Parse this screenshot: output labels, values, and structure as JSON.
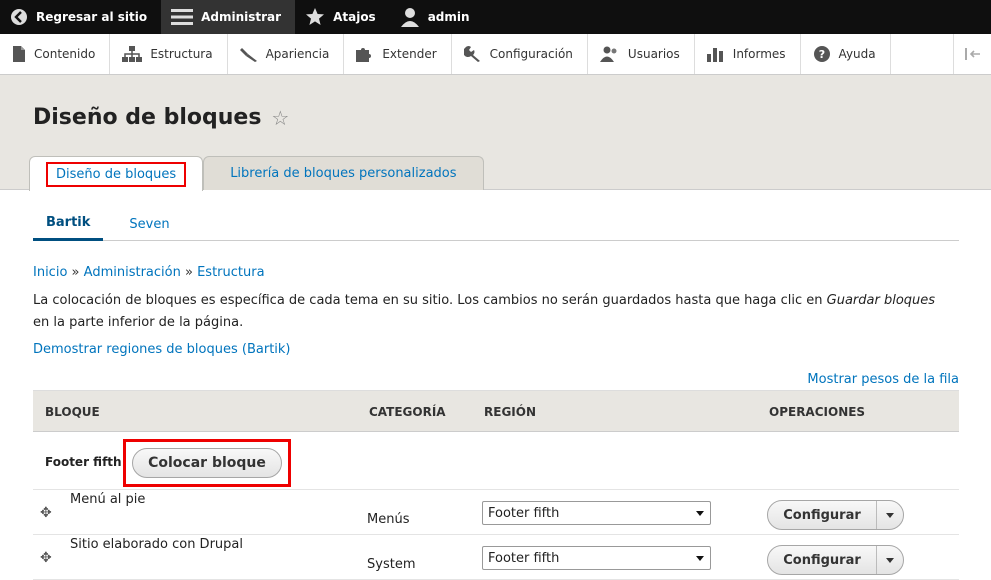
{
  "toolbar": {
    "back_label": "Regresar al sitio",
    "admin_label": "Administrar",
    "shortcuts_label": "Atajos",
    "user_label": "admin"
  },
  "tray": {
    "items": [
      {
        "label": "Contenido",
        "icon": "file-icon"
      },
      {
        "label": "Estructura",
        "icon": "sitemap-icon"
      },
      {
        "label": "Apariencia",
        "icon": "brush-icon"
      },
      {
        "label": "Extender",
        "icon": "puzzle-icon"
      },
      {
        "label": "Configuración",
        "icon": "wrench-icon"
      },
      {
        "label": "Usuarios",
        "icon": "people-icon"
      },
      {
        "label": "Informes",
        "icon": "bar-chart-icon"
      },
      {
        "label": "Ayuda",
        "icon": "help-icon"
      }
    ]
  },
  "page": {
    "title": "Diseño de bloques",
    "tabs": [
      {
        "label": "Diseño de bloques"
      },
      {
        "label": "Librería de bloques personalizados"
      }
    ],
    "subtabs": [
      {
        "label": "Bartik"
      },
      {
        "label": "Seven"
      }
    ],
    "breadcrumb": {
      "home": "Inicio",
      "admin": "Administración",
      "structure": "Estructura",
      "sep": "»"
    },
    "description_pre": "La colocación de bloques es específica de cada tema en su sitio. Los cambios no serán guardados hasta que haga clic en ",
    "description_em": "Guardar bloques",
    "description_post": " en la parte inferior de la página.",
    "demo_link": "Demostrar regiones de bloques (Bartik)",
    "weights_link": "Mostrar pesos de la fila"
  },
  "table": {
    "headers": {
      "block": "BLOQUE",
      "category": "CATEGORÍA",
      "region": "REGIÓN",
      "operations": "OPERACIONES"
    },
    "region_name": "Footer fifth",
    "place_block_label": "Colocar bloque",
    "rows": [
      {
        "name": "Menú al pie",
        "category": "Menús",
        "region": "Footer fifth",
        "op": "Configurar"
      },
      {
        "name": "Sitio elaborado con Drupal",
        "category": "System",
        "region": "Footer fifth",
        "op": "Configurar"
      }
    ]
  }
}
